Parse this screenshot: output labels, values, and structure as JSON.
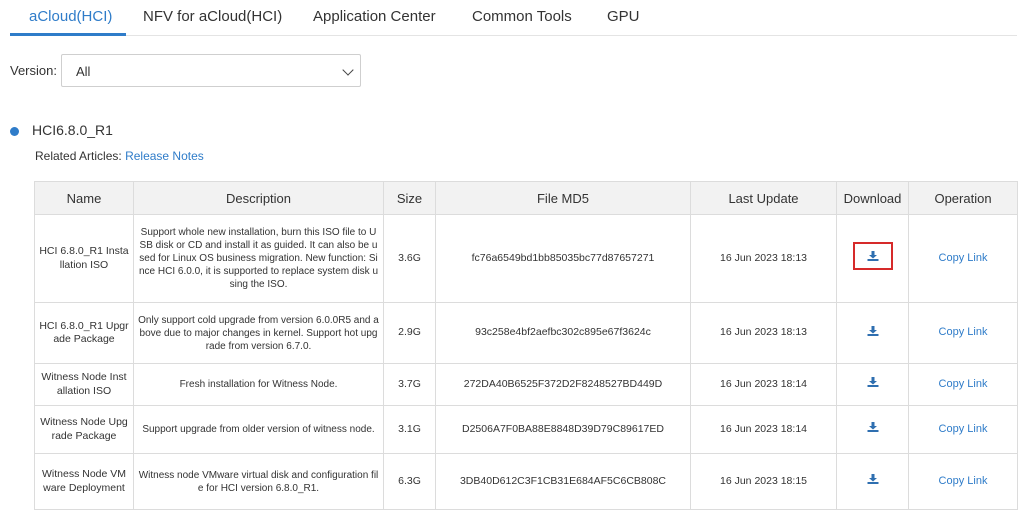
{
  "tabs": [
    {
      "label": "aCloud(HCI)",
      "active": true
    },
    {
      "label": "NFV for aCloud(HCI)",
      "active": false
    },
    {
      "label": "Application Center",
      "active": false
    },
    {
      "label": "Common Tools",
      "active": false
    },
    {
      "label": "GPU",
      "active": false
    }
  ],
  "version": {
    "label": "Version:",
    "selected": "All"
  },
  "release": {
    "title": "HCI6.8.0_R1",
    "related_label": "Related Articles:",
    "related_link": "Release Notes"
  },
  "table": {
    "headers": [
      "Name",
      "Description",
      "Size",
      "File MD5",
      "Last Update",
      "Download",
      "Operation"
    ],
    "rows": [
      {
        "name": "HCI 6.8.0_R1 Installation ISO",
        "description": "Support whole new installation, burn this ISO file to USB disk or CD and install it as guided. It can also be used for Linux OS business migration. New function: Since HCI 6.0.0, it is supported to replace system disk using the ISO.",
        "size": "3.6G",
        "md5": "fc76a6549bd1bb85035bc77d87657271",
        "updated": "16 Jun 2023 18:13",
        "operation": "Copy Link"
      },
      {
        "name": "HCI 6.8.0_R1 Upgrade Package",
        "description": "Only support cold upgrade from version 6.0.0R5 and above due to major changes in kernel. Support hot upgrade from version 6.7.0.",
        "size": "2.9G",
        "md5": "93c258e4bf2aefbc302c895e67f3624c",
        "updated": "16 Jun 2023 18:13",
        "operation": "Copy Link"
      },
      {
        "name": "Witness Node Installation ISO",
        "description": "Fresh installation for Witness Node.",
        "size": "3.7G",
        "md5": "272DA40B6525F372D2F8248527BD449D",
        "updated": "16 Jun 2023 18:14",
        "operation": "Copy Link"
      },
      {
        "name": "Witness Node Upgrade Package",
        "description": "Support upgrade from older version of witness node.",
        "size": "3.1G",
        "md5": "D2506A7F0BA88E8848D39D79C89617ED",
        "updated": "16 Jun 2023 18:14",
        "operation": "Copy Link"
      },
      {
        "name": "Witness Node VMware Deployment",
        "description": "Witness node VMware virtual disk and configuration file for HCI version 6.8.0_R1.",
        "size": "6.3G",
        "md5": "3DB40D612C3F1CB31E684AF5C6CB808C",
        "updated": "16 Jun 2023 18:15",
        "operation": "Copy Link"
      }
    ]
  },
  "colors": {
    "accent": "#2f7cc9",
    "highlight": "#d62a2a",
    "header_bg": "#f2f2f2"
  },
  "icons": {
    "download": "download-icon",
    "dropdown": "chevron-down-icon",
    "bullet": "bullet-dot-icon"
  }
}
